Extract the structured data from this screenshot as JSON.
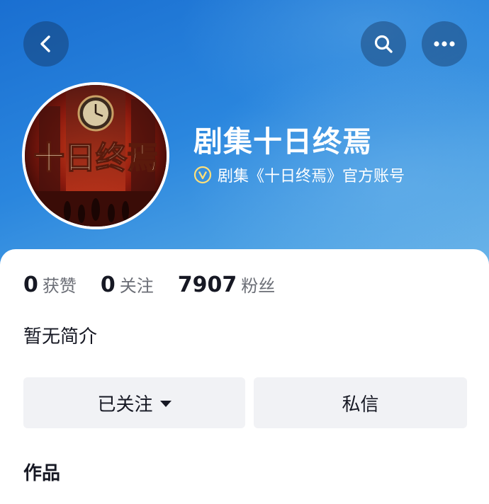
{
  "nav": {
    "back_icon": "chevron-left-icon",
    "search_icon": "search-icon",
    "more_icon": "more-horizontal-icon"
  },
  "profile": {
    "avatar_text": "十日终焉",
    "name": "剧集十日终焉",
    "verified_icon": "verified-v-icon",
    "verified_text": "剧集《十日终焉》官方账号"
  },
  "stats": [
    {
      "value": "0",
      "label": "获赞"
    },
    {
      "value": "0",
      "label": "关注"
    },
    {
      "value": "7907",
      "label": "粉丝"
    }
  ],
  "bio": "暂无简介",
  "actions": {
    "follow_label": "已关注",
    "message_label": "私信"
  },
  "tabs": {
    "works_label": "作品"
  },
  "colors": {
    "header_blue": "#2a86de",
    "button_bg": "#f1f2f5",
    "text_primary": "#161823",
    "text_secondary": "#6b6e76"
  }
}
